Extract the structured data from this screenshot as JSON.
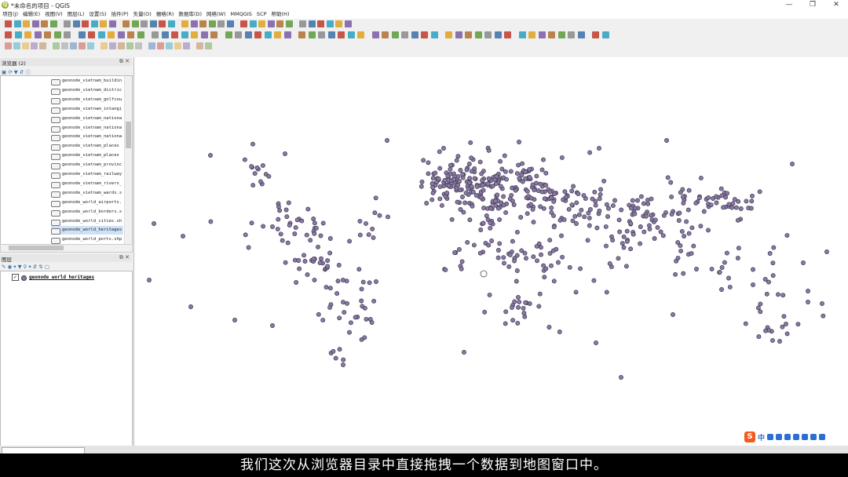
{
  "window": {
    "title": "*未命名的项目 - QGIS",
    "controls": [
      "—",
      "❐",
      "✕"
    ]
  },
  "menu": [
    "项目(J)",
    "编辑(E)",
    "视图(V)",
    "图层(L)",
    "设置(S)",
    "插件(P)",
    "矢量(O)",
    "栅格(R)",
    "数据库(D)",
    "网络(W)",
    "MMQGIS",
    "SCP",
    "帮助(H)"
  ],
  "browser_panel": {
    "title": "浏览器 (2)",
    "items": [
      "geonode_vietnam_buildin",
      "geonode_vietnam_distric",
      "geonode_vietnam_golfcou",
      "geonode_vietnam_intangi",
      "geonode_vietnam_nationa",
      "geonode_vietnam_nationa",
      "geonode_vietnam_nationa",
      "geonode_vietnam_places",
      "geonode_vietnam_places",
      "geonode_vietnam_provinc",
      "geonode_vietnam_railway",
      "geonode_vietnam_rivers_",
      "geonode_vietnam_wards.s",
      "geonode_world_airports.",
      "geonode_world_borders.s",
      "geonode_world_cities.sh",
      "geonode_world_heritages",
      "geonode_world_ports.shp"
    ],
    "selected_index": 16
  },
  "layers_panel": {
    "title": "图层",
    "layers": [
      {
        "name": "geonode_world_heritages",
        "checked": true
      }
    ]
  },
  "map": {
    "point_fill": "#8a7aa3",
    "point_stroke": "#3d3550"
  },
  "ime": {
    "lang": "中"
  },
  "subtitle": "我们这次从浏览器目录中直接拖拽一个数据到地图窗口中。"
}
